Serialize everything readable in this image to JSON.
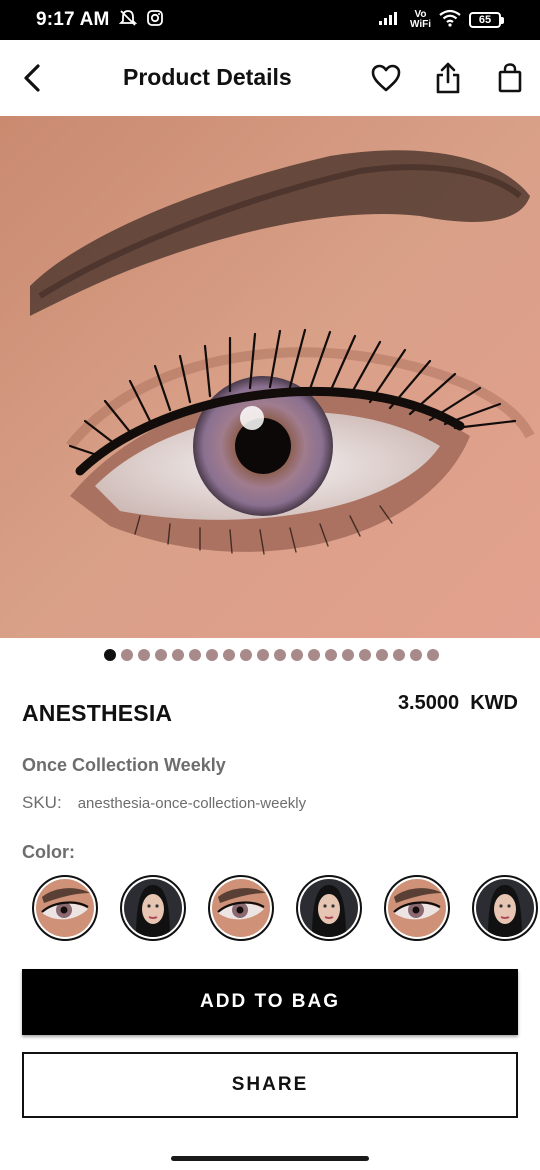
{
  "status_bar": {
    "time": "9:17 AM",
    "network_top": "Vo",
    "network_bottom": "WiFi",
    "battery": "65"
  },
  "header": {
    "title": "Product Details",
    "icons": [
      "back-arrow-icon",
      "heart-icon",
      "share-icon",
      "shopping-bag-icon"
    ]
  },
  "gallery": {
    "image_count": 20,
    "active_index": 0
  },
  "product": {
    "name": "ANESTHESIA",
    "price": "3.5000  KWD",
    "collection": "Once Collection Weekly",
    "sku_label": "SKU:",
    "sku_value": "anesthesia-once-collection-weekly",
    "color_label": "Color:"
  },
  "color_swatches": [
    {
      "type": "eye"
    },
    {
      "type": "model"
    },
    {
      "type": "eye"
    },
    {
      "type": "model"
    },
    {
      "type": "eye"
    },
    {
      "type": "model"
    }
  ],
  "actions": {
    "add_to_bag": "ADD TO BAG",
    "share": "SHARE"
  },
  "colors": {
    "primary": "#000000",
    "dot_inactive": "#a88a8a",
    "muted_text": "#6d6d6d",
    "skin": "#d69a7e"
  }
}
